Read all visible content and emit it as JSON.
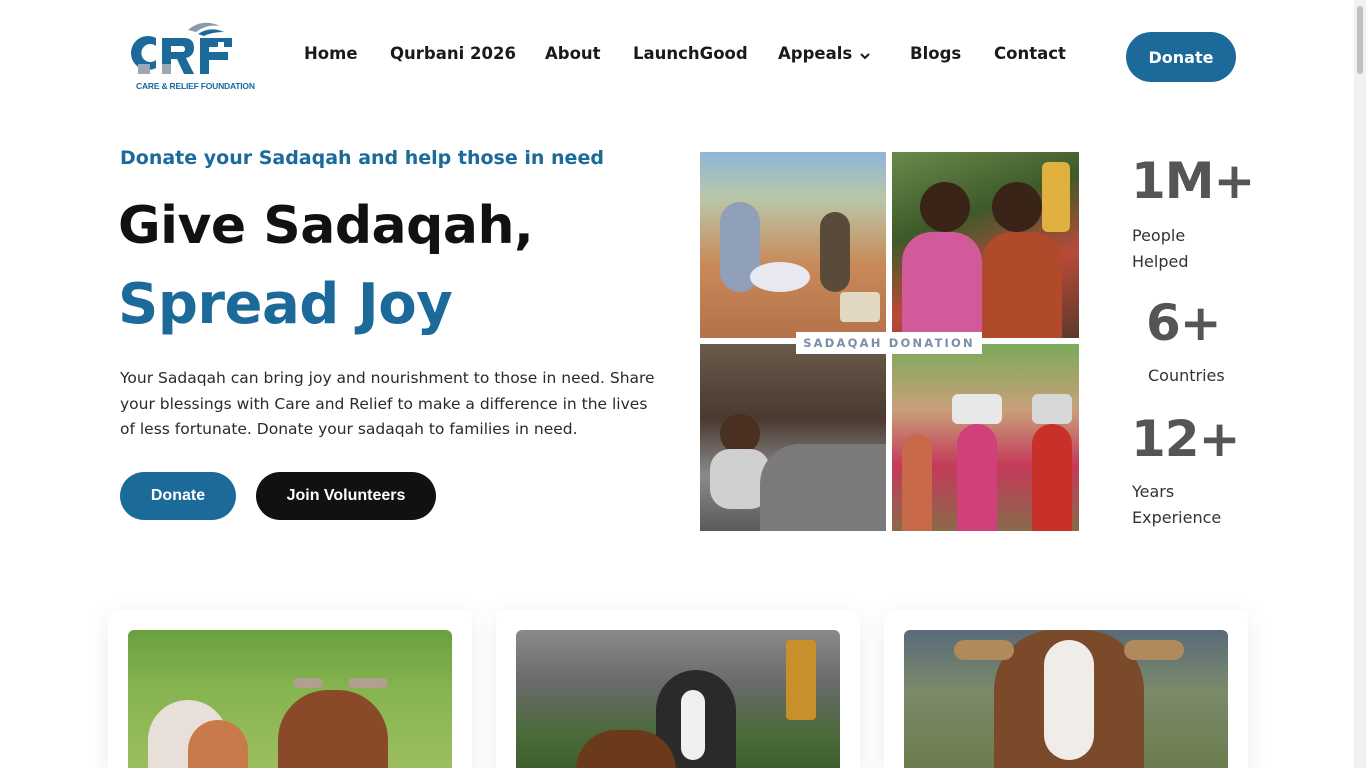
{
  "header": {
    "logo_text": "CARE & RELIEF FOUNDATION",
    "nav": [
      {
        "label": "Home"
      },
      {
        "label": "Qurbani 2026"
      },
      {
        "label": "About"
      },
      {
        "label": "LaunchGood"
      },
      {
        "label": "Appeals",
        "has_dropdown": true
      },
      {
        "label": "Blogs"
      },
      {
        "label": "Contact"
      }
    ],
    "donate_label": "Donate"
  },
  "hero": {
    "subtitle": "Donate your Sadaqah and help those in need",
    "title_line1": "Give Sadaqah,",
    "title_line2": "Spread Joy",
    "description": "Your Sadaqah can bring joy and nourishment to those in need. Share your blessings with Care and Relief to make a difference in the lives of less fortunate. Donate your sadaqah to families in need.",
    "donate_button": "Donate",
    "volunteer_button": "Join Volunteers",
    "collage_label": "SADAQAH DONATION"
  },
  "stats": [
    {
      "value": "1M+",
      "label_line1": "People",
      "label_line2": "Helped"
    },
    {
      "value": "6+",
      "label_line1": "Countries",
      "label_line2": ""
    },
    {
      "value": "12+",
      "label_line1": "Years",
      "label_line2": "Experience"
    }
  ],
  "colors": {
    "brand_blue": "#1b6a9a",
    "dark": "#111111",
    "stat_gray": "#555555"
  }
}
